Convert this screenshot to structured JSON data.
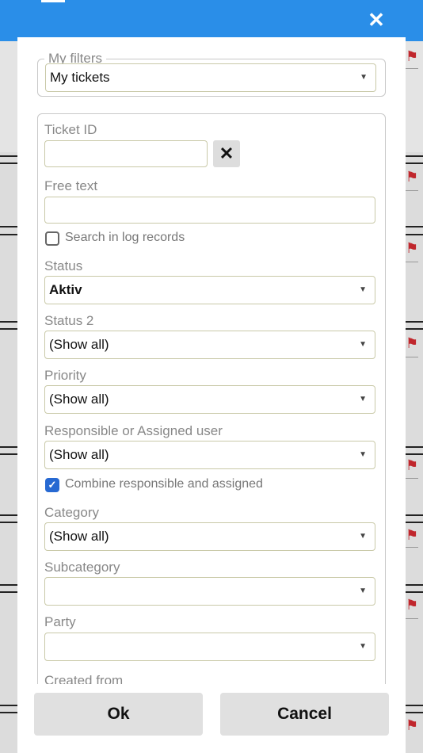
{
  "modal": {
    "close_icon": "close-icon"
  },
  "my_filters": {
    "legend": "My filters",
    "value": "My tickets"
  },
  "ticket_id": {
    "label": "Ticket ID",
    "value": "",
    "clear_icon": "✕"
  },
  "free_text": {
    "label": "Free text",
    "value": ""
  },
  "search_log": {
    "label": "Search in log records",
    "checked": false
  },
  "status": {
    "label": "Status",
    "value": "Aktiv"
  },
  "status2": {
    "label": "Status 2",
    "value": "(Show all)"
  },
  "priority": {
    "label": "Priority",
    "value": "(Show all)"
  },
  "responsible": {
    "label": "Responsible or Assigned user",
    "value": "(Show all)"
  },
  "combine": {
    "label": "Combine responsible and assigned",
    "checked": true
  },
  "category": {
    "label": "Category",
    "value": "(Show all)"
  },
  "subcategory": {
    "label": "Subcategory",
    "value": ""
  },
  "party": {
    "label": "Party",
    "value": ""
  },
  "created_from": {
    "label": "Created from"
  },
  "footer": {
    "ok_label": "Ok",
    "cancel_label": "Cancel"
  },
  "colors": {
    "accent": "#2a8ee8",
    "checkbox": "#2769d2",
    "flag": "#c0272d"
  }
}
